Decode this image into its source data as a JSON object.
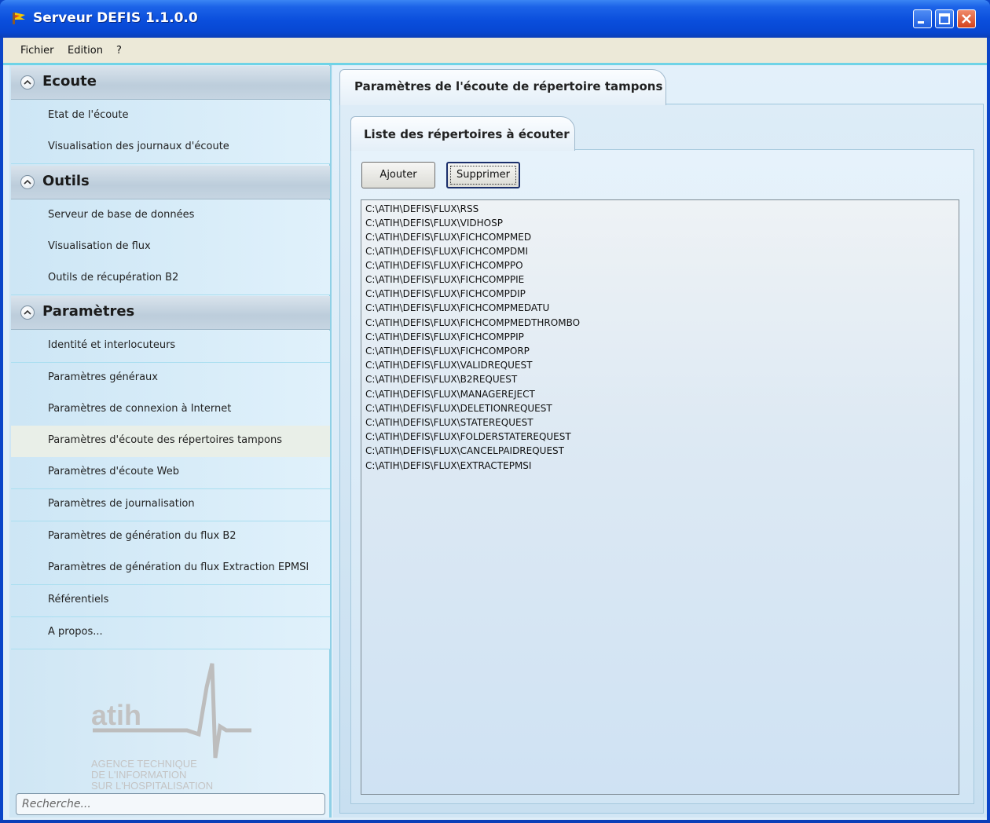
{
  "window": {
    "title": "Serveur DEFIS 1.1.0.0"
  },
  "menu": [
    "Fichier",
    "Edition",
    "?"
  ],
  "sidebar": {
    "sections": [
      {
        "title": "Ecoute",
        "items": [
          "Etat de l'écoute",
          "Visualisation des journaux d'écoute"
        ]
      },
      {
        "title": "Outils",
        "items": [
          "Serveur de base de données",
          "Visualisation de flux",
          "Outils de récupération B2"
        ]
      },
      {
        "title": "Paramètres",
        "items": [
          "Identité et interlocuteurs",
          "Paramètres généraux",
          "Paramètres de connexion à Internet",
          "Paramètres d'écoute des répertoires tampons",
          "Paramètres d'écoute Web",
          "Paramètres de journalisation",
          "Paramètres de génération du flux B2",
          "Paramètres de génération du flux Extraction EPMSI",
          "Référentiels",
          "A propos..."
        ]
      }
    ],
    "selected": "Paramètres d'écoute des répertoires tampons",
    "logo": {
      "name": "atih",
      "lines": [
        "AGENCE TECHNIQUE",
        "DE L'INFORMATION",
        "SUR L'HOSPITALISATION"
      ]
    },
    "search_placeholder": "Recherche..."
  },
  "main": {
    "tab_title": "Paramètres de l'écoute de répertoire tampons",
    "inner_tab_title": "Liste des répertoires à écouter",
    "buttons": {
      "add": "Ajouter",
      "remove": "Supprimer"
    },
    "directories": [
      "C:\\ATIH\\DEFIS\\FLUX\\RSS",
      "C:\\ATIH\\DEFIS\\FLUX\\VIDHOSP",
      "C:\\ATIH\\DEFIS\\FLUX\\FICHCOMPMED",
      "C:\\ATIH\\DEFIS\\FLUX\\FICHCOMPDMI",
      "C:\\ATIH\\DEFIS\\FLUX\\FICHCOMPPO",
      "C:\\ATIH\\DEFIS\\FLUX\\FICHCOMPPIE",
      "C:\\ATIH\\DEFIS\\FLUX\\FICHCOMPDIP",
      "C:\\ATIH\\DEFIS\\FLUX\\FICHCOMPMEDATU",
      "C:\\ATIH\\DEFIS\\FLUX\\FICHCOMPMEDTHROMBO",
      "C:\\ATIH\\DEFIS\\FLUX\\FICHCOMPPIP",
      "C:\\ATIH\\DEFIS\\FLUX\\FICHCOMPORP",
      "C:\\ATIH\\DEFIS\\FLUX\\VALIDREQUEST",
      "C:\\ATIH\\DEFIS\\FLUX\\B2REQUEST",
      "C:\\ATIH\\DEFIS\\FLUX\\MANAGEREJECT",
      "C:\\ATIH\\DEFIS\\FLUX\\DELETIONREQUEST",
      "C:\\ATIH\\DEFIS\\FLUX\\STATEREQUEST",
      "C:\\ATIH\\DEFIS\\FLUX\\FOLDERSTATEREQUEST",
      "C:\\ATIH\\DEFIS\\FLUX\\CANCELPAIDREQUEST",
      "C:\\ATIH\\DEFIS\\FLUX\\EXTRACTEPMSI"
    ]
  },
  "colors": {
    "title_bar": "#0a4edc",
    "accent_line": "#6fd3e6",
    "sidebar_bg": "#cfe6f4"
  }
}
